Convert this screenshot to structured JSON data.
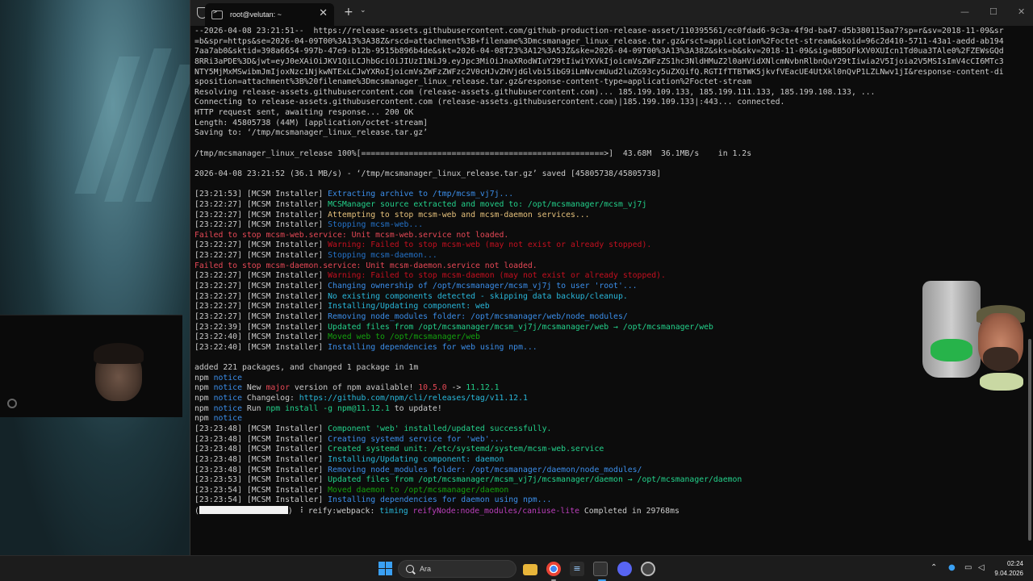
{
  "window": {
    "tab_title": "root@velutan: ~",
    "close_glyph": "✕",
    "new_tab_glyph": "+",
    "dropdown_glyph": "⌄"
  },
  "terminal": {
    "lines": [
      [
        {
          "t": "--2026-04-08 23:21:51--  https://release-assets.githubusercontent.com/github-production-release-asset/110395561/ec0fdad6-9c3a-4f9d-ba47-d5b380115aa7?sp=r&sv=2018-11-09&sr",
          "c": ""
        }
      ],
      [
        {
          "t": "=b&spr=https&se=2026-04-09T00%3A13%3A38Z&rscd=attachment%3B+filename%3Dmcsmanager_linux_release.tar.gz&rsct=application%2Foctet-stream&skoid=96c2d410-5711-43a1-aedd-ab194",
          "c": ""
        }
      ],
      [
        {
          "t": "7aa7ab0&sktid=398a6654-997b-47e9-b12b-9515b896b4de&skt=2026-04-08T23%3A12%3A53Z&ske=2026-04-09T00%3A13%3A38Z&sks=b&skv=2018-11-09&sig=BB5OFkXV0XUIcn1Td0ua3TAle0%2FZEWsGQd",
          "c": ""
        }
      ],
      [
        {
          "t": "8RRi3aPDE%3D&jwt=eyJ0eXAiOiJKV1QiLCJhbGciOiJIUzI1NiJ9.eyJpc3MiOiJnaXRodWIuY29tIiwiYXVkIjoicmVsZWFzZS1hc3NldHMuZ2l0aHVidXNlcmNvbnRlbnQuY29tIiwia2V5Ijoia2V5MSIsImV4cCI6MTc3",
          "c": ""
        }
      ],
      [
        {
          "t": "NTY5MjMxMSwibmJmIjoxNzc1NjkwNTExLCJwYXRoIjoicmVsZWFzZWFzc2V0cHJvZHVjdGlvbi5ibG9iLmNvcmUud2luZG93cy5uZXQifQ.RGTIfTTBTWK5jkvfVEacUE4UtXkl0nQvP1LZLNwv1jI&response-content-di",
          "c": ""
        }
      ],
      [
        {
          "t": "sposition=attachment%3B%20filename%3Dmcsmanager_linux_release.tar.gz&response-content-type=application%2Foctet-stream",
          "c": ""
        }
      ],
      [
        {
          "t": "Resolving release-assets.githubusercontent.com (release-assets.githubusercontent.com)... 185.199.109.133, 185.199.111.133, 185.199.108.133, ...",
          "c": ""
        }
      ],
      [
        {
          "t": "Connecting to release-assets.githubusercontent.com (release-assets.githubusercontent.com)|185.199.109.133|:443... connected.",
          "c": ""
        }
      ],
      [
        {
          "t": "HTTP request sent, awaiting response... 200 OK",
          "c": ""
        }
      ],
      [
        {
          "t": "Length: 45805738 (44M) [application/octet-stream]",
          "c": ""
        }
      ],
      [
        {
          "t": "Saving to: ‘/tmp/mcsmanager_linux_release.tar.gz’",
          "c": ""
        }
      ],
      [
        {
          "t": "",
          "c": ""
        }
      ],
      [
        {
          "t": "/tmp/mcsmanager_linux_release 100%[===================================================>]  43.68M  36.1MB/s    in 1.2s",
          "c": ""
        }
      ],
      [
        {
          "t": "",
          "c": ""
        }
      ],
      [
        {
          "t": "2026-04-08 23:21:52 (36.1 MB/s) - ‘/tmp/mcsmanager_linux_release.tar.gz’ saved [45805738/45805738]",
          "c": ""
        }
      ],
      [
        {
          "t": "",
          "c": ""
        }
      ],
      [
        {
          "t": "[23:21:53] [MCSM Installer] ",
          "c": ""
        },
        {
          "t": "Extracting archive to /tmp/mcsm_vj7j...",
          "c": "c-blue"
        }
      ],
      [
        {
          "t": "[23:22:27] [MCSM Installer] ",
          "c": ""
        },
        {
          "t": "MCSManager source extracted and moved to: /opt/mcsmanager/mcsm_vj7j",
          "c": "c-green"
        }
      ],
      [
        {
          "t": "[23:22:27] [MCSM Installer] ",
          "c": ""
        },
        {
          "t": "Attempting to stop mcsm-web and mcsm-daemon services...",
          "c": "c-yellow"
        }
      ],
      [
        {
          "t": "[23:22:27] [MCSM Installer] ",
          "c": ""
        },
        {
          "t": "Stopping mcsm-web...",
          "c": "c-dblue"
        }
      ],
      [
        {
          "t": "Failed to stop mcsm-web.service: Unit mcsm-web.service not loaded.",
          "c": "c-red"
        }
      ],
      [
        {
          "t": "[23:22:27] [MCSM Installer] ",
          "c": ""
        },
        {
          "t": "Warning: Failed to stop mcsm-web (may not exist or already stopped).",
          "c": "c-dred"
        }
      ],
      [
        {
          "t": "[23:22:27] [MCSM Installer] ",
          "c": ""
        },
        {
          "t": "Stopping mcsm-daemon...",
          "c": "c-dblue"
        }
      ],
      [
        {
          "t": "Failed to stop mcsm-daemon.service: Unit mcsm-daemon.service not loaded.",
          "c": "c-red"
        }
      ],
      [
        {
          "t": "[23:22:27] [MCSM Installer] ",
          "c": ""
        },
        {
          "t": "Warning: Failed to stop mcsm-daemon (may not exist or already stopped).",
          "c": "c-dred"
        }
      ],
      [
        {
          "t": "[23:22:27] [MCSM Installer] ",
          "c": ""
        },
        {
          "t": "Changing ownership of /opt/mcsmanager/mcsm_vj7j to user 'root'...",
          "c": "c-blue"
        }
      ],
      [
        {
          "t": "[23:22:27] [MCSM Installer] ",
          "c": ""
        },
        {
          "t": "No existing components detected - skipping data backup/cleanup.",
          "c": "c-cyan"
        }
      ],
      [
        {
          "t": "[23:22:27] [MCSM Installer] ",
          "c": ""
        },
        {
          "t": "Installing/Updating component: web",
          "c": "c-cyan"
        }
      ],
      [
        {
          "t": "[23:22:27] [MCSM Installer] ",
          "c": ""
        },
        {
          "t": "Removing node_modules folder: /opt/mcsmanager/web/node_modules/",
          "c": "c-blue"
        }
      ],
      [
        {
          "t": "[23:22:39] [MCSM Installer] ",
          "c": ""
        },
        {
          "t": "Updated files from /opt/mcsmanager/mcsm_vj7j/mcsmanager/web → /opt/mcsmanager/web",
          "c": "c-green"
        }
      ],
      [
        {
          "t": "[23:22:40] [MCSM Installer] ",
          "c": ""
        },
        {
          "t": "Moved web to /opt/mcsmanager/web",
          "c": "c-gdark"
        }
      ],
      [
        {
          "t": "[23:22:40] [MCSM Installer] ",
          "c": ""
        },
        {
          "t": "Installing dependencies for web using npm...",
          "c": "c-blue"
        }
      ],
      [
        {
          "t": "",
          "c": ""
        }
      ],
      [
        {
          "t": "added 221 packages, and changed 1 package in 1m",
          "c": ""
        }
      ],
      [
        {
          "t": "npm ",
          "c": ""
        },
        {
          "t": "notice",
          "c": "c-blue"
        }
      ],
      [
        {
          "t": "npm ",
          "c": ""
        },
        {
          "t": "notice",
          "c": "c-blue"
        },
        {
          "t": " New ",
          "c": ""
        },
        {
          "t": "major",
          "c": "c-red"
        },
        {
          "t": " version of npm available! ",
          "c": ""
        },
        {
          "t": "10.5.0",
          "c": "c-red"
        },
        {
          "t": " -> ",
          "c": ""
        },
        {
          "t": "11.12.1",
          "c": "c-green"
        }
      ],
      [
        {
          "t": "npm ",
          "c": ""
        },
        {
          "t": "notice",
          "c": "c-blue"
        },
        {
          "t": " Changelog: ",
          "c": ""
        },
        {
          "t": "https://github.com/npm/cli/releases/tag/v11.12.1",
          "c": "c-cyan"
        }
      ],
      [
        {
          "t": "npm ",
          "c": ""
        },
        {
          "t": "notice",
          "c": "c-blue"
        },
        {
          "t": " Run ",
          "c": ""
        },
        {
          "t": "npm install -g npm@11.12.1",
          "c": "c-green"
        },
        {
          "t": " to update!",
          "c": ""
        }
      ],
      [
        {
          "t": "npm ",
          "c": ""
        },
        {
          "t": "notice",
          "c": "c-blue"
        }
      ],
      [
        {
          "t": "[23:23:48] [MCSM Installer] ",
          "c": ""
        },
        {
          "t": "Component 'web' installed/updated successfully.",
          "c": "c-green"
        }
      ],
      [
        {
          "t": "[23:23:48] [MCSM Installer] ",
          "c": ""
        },
        {
          "t": "Creating systemd service for 'web'...",
          "c": "c-blue"
        }
      ],
      [
        {
          "t": "[23:23:48] [MCSM Installer] ",
          "c": ""
        },
        {
          "t": "Created systemd unit: /etc/systemd/system/mcsm-web.service",
          "c": "c-green"
        }
      ],
      [
        {
          "t": "[23:23:48] [MCSM Installer] ",
          "c": ""
        },
        {
          "t": "Installing/Updating component: daemon",
          "c": "c-cyan"
        }
      ],
      [
        {
          "t": "[23:23:48] [MCSM Installer] ",
          "c": ""
        },
        {
          "t": "Removing node_modules folder: /opt/mcsmanager/daemon/node_modules/",
          "c": "c-blue"
        }
      ],
      [
        {
          "t": "[23:23:53] [MCSM Installer] ",
          "c": ""
        },
        {
          "t": "Updated files from /opt/mcsmanager/mcsm_vj7j/mcsmanager/daemon → /opt/mcsmanager/daemon",
          "c": "c-green"
        }
      ],
      [
        {
          "t": "[23:23:54] [MCSM Installer] ",
          "c": ""
        },
        {
          "t": "Moved daemon to /opt/mcsmanager/daemon",
          "c": "c-gdark"
        }
      ],
      [
        {
          "t": "[23:23:54] [MCSM Installer] ",
          "c": ""
        },
        {
          "t": "Installing dependencies for daemon using npm...",
          "c": "c-blue"
        }
      ],
      [
        {
          "t": "(",
          "c": ""
        },
        {
          "t": "#BLOCK#",
          "c": ""
        },
        {
          "t": ") ⠸ reify:webpack: ",
          "c": ""
        },
        {
          "t": "timing",
          "c": "c-cyan"
        },
        {
          "t": " ",
          "c": ""
        },
        {
          "t": "reifyNode:node_modules/caniuse-lite",
          "c": "c-magenta"
        },
        {
          "t": " Completed in 29768ms",
          "c": ""
        }
      ]
    ]
  },
  "taskbar": {
    "search_placeholder": "Ara",
    "time": "02:24",
    "date": "9.04.2026",
    "accent": "#3aa0f3"
  }
}
